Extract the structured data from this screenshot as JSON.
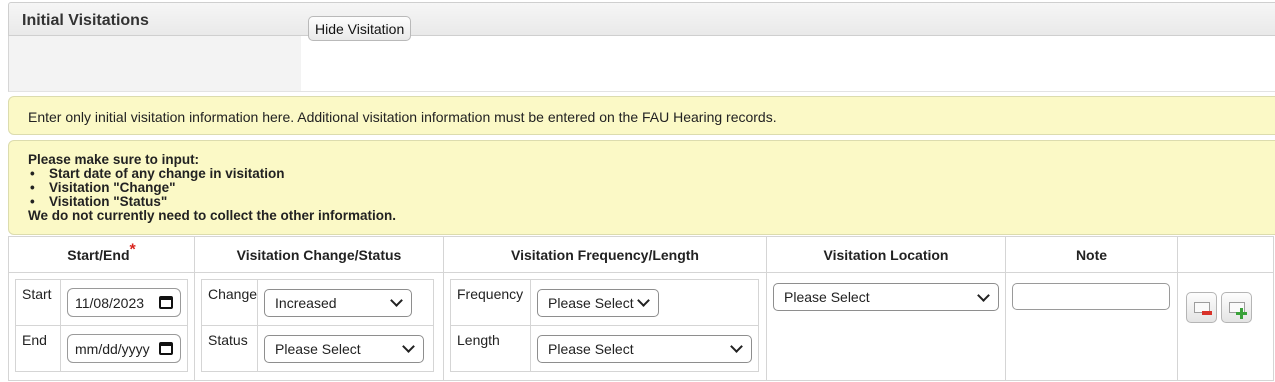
{
  "panel": {
    "title": "Initial Visitations"
  },
  "hide_button": "Hide Visitation",
  "notices": {
    "info": "Enter only initial visitation information here. Additional visitation information must be entered on the FAU Hearing records.",
    "heading": "Please make sure to input:",
    "items": [
      "Start date of any change in visitation",
      "Visitation \"Change\"",
      "Visitation \"Status\""
    ],
    "footer": "We do not currently need to collect the other information."
  },
  "table": {
    "headers": {
      "start_end": "Start/End",
      "required_mark": "*",
      "change_status": "Visitation Change/Status",
      "frequency_length": "Visitation Frequency/Length",
      "location": "Visitation Location",
      "note": "Note"
    },
    "row": {
      "start_label": "Start",
      "start_value": "11/08/2023",
      "end_label": "End",
      "end_placeholder": "mm/dd/yyyy",
      "change_label": "Change",
      "change_value": "Increased",
      "status_label": "Status",
      "status_value": "Please Select",
      "frequency_label": "Frequency",
      "frequency_value": "Please Select",
      "length_label": "Length",
      "length_value": "Please Select",
      "location_value": "Please Select",
      "note_value": ""
    },
    "actions": {
      "remove_icon": "remove-row-icon",
      "add_icon": "add-row-icon"
    }
  }
}
